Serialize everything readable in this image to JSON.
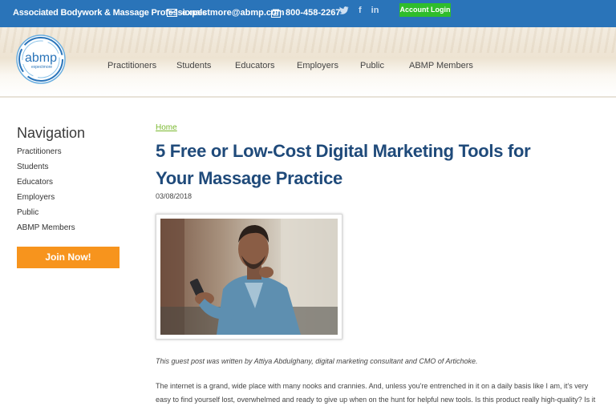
{
  "topbar": {
    "org_name": "Associated Bodywork & Massage Professionals",
    "email": "expectmore@abmp.com",
    "phone": "800-458-2267",
    "login_label": "Account Login",
    "colors": {
      "bar": "#2a74b9",
      "login": "#2fbd2b"
    }
  },
  "logo": {
    "wordmark": "abmp",
    "tagline": "expectmore"
  },
  "main_nav": [
    "Practitioners",
    "Students",
    "Educators",
    "Employers",
    "Public",
    "ABMP Members"
  ],
  "sidebar": {
    "title": "Navigation",
    "items": [
      "Practitioners",
      "Students",
      "Educators",
      "Employers",
      "Public",
      "ABMP Members"
    ],
    "join_label": "Join Now!",
    "join_color": "#f7941d"
  },
  "article": {
    "breadcrumb": "Home",
    "title": "5 Free or Low-Cost Digital Marketing Tools for Your Massage Practice",
    "date": "03/08/2018",
    "caption": "This guest post was written by Attiya Abdulghany, digital marketing consultant and CMO of Artichoke.",
    "body": "The internet is a grand, wide place with many nooks and crannies. And, unless you're entrenched in it on a daily basis like I am, it's very easy to find yourself lost, overwhelmed and ready to give up when on the hunt for helpful new tools. Is this product really high-quality? Is it easy to use? How will it actually benefit me?",
    "title_color": "#1f4a7a"
  }
}
